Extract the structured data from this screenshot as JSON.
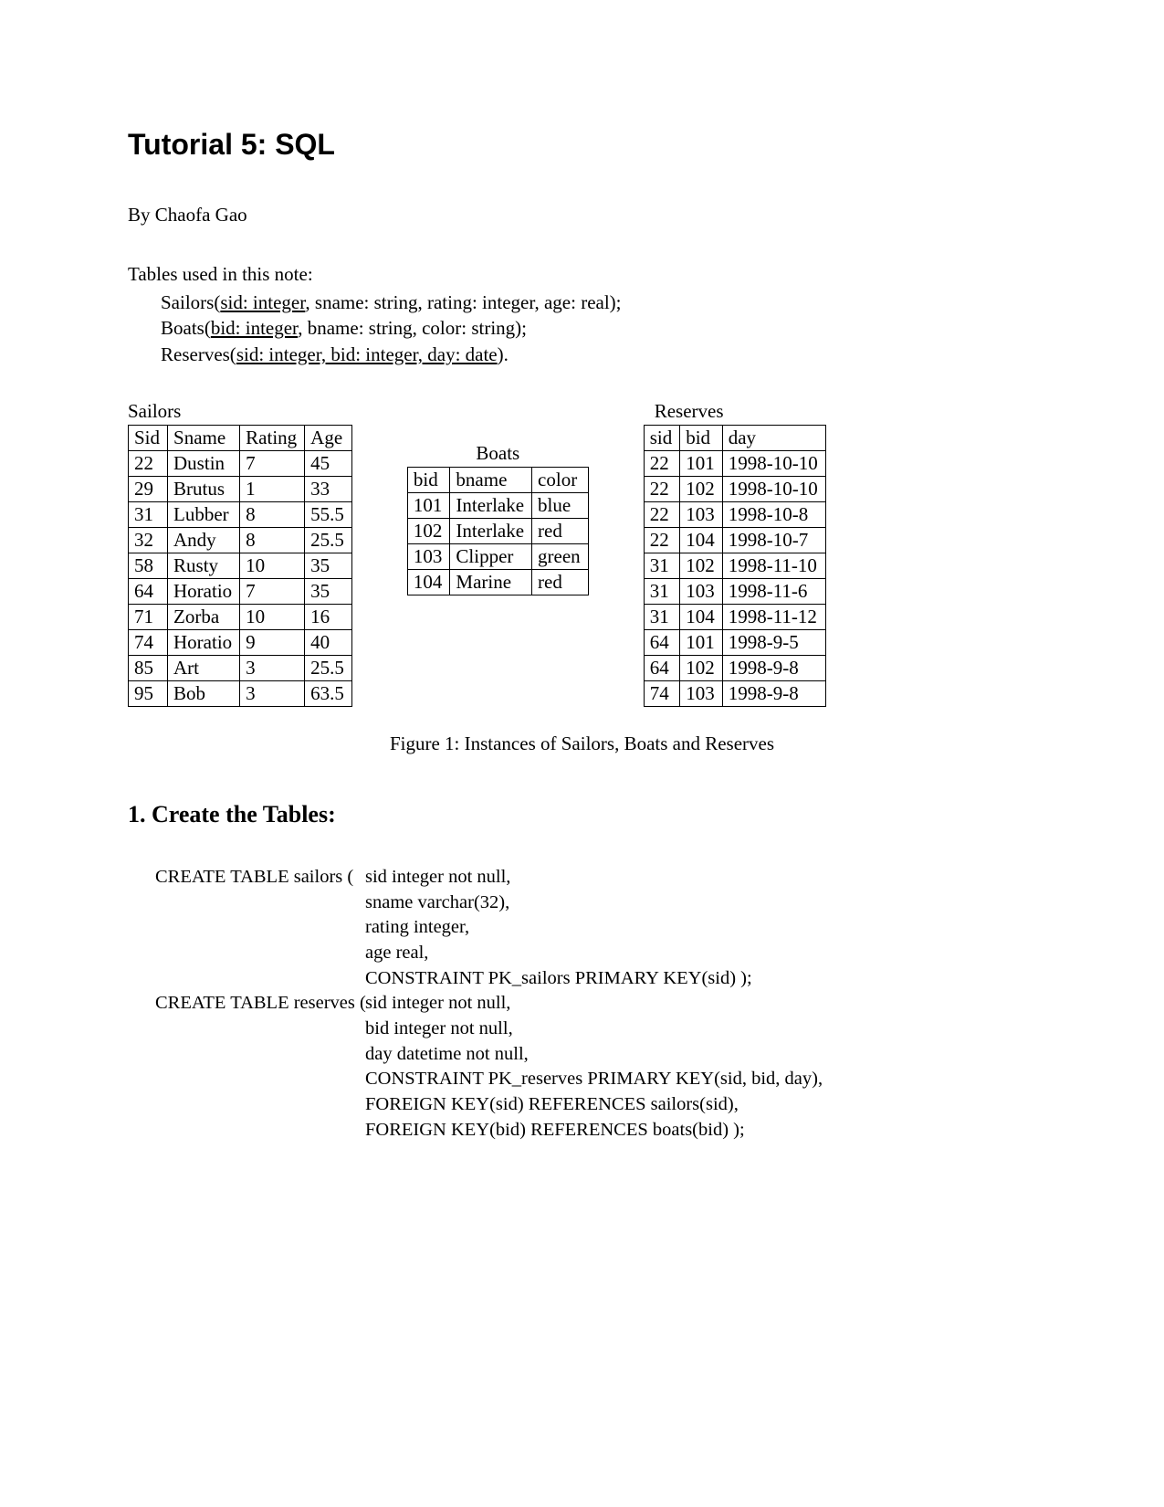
{
  "title": "Tutorial 5: SQL",
  "author": "By Chaofa Gao",
  "tables_intro": "Tables used in this note:",
  "schemas": {
    "sailors_prefix": "Sailors(",
    "sailors_u": "sid: integer",
    "sailors_rest": ", sname: string, rating: integer, age: real);",
    "boats_prefix": "Boats(",
    "boats_u": "bid: integer",
    "boats_rest": ", bname: string, color: string);",
    "reserves_prefix": "Reserves(",
    "reserves_u": "sid: integer, bid: integer, day: date",
    "reserves_rest": ")."
  },
  "sailors_label": "Sailors",
  "sailors_headers": [
    "Sid",
    "Sname",
    "Rating",
    "Age"
  ],
  "sailors_rows": [
    [
      "22",
      "Dustin",
      "7",
      "45"
    ],
    [
      "29",
      "Brutus",
      "1",
      "33"
    ],
    [
      "31",
      "Lubber",
      "8",
      "55.5"
    ],
    [
      "32",
      "Andy",
      "8",
      "25.5"
    ],
    [
      "58",
      "Rusty",
      "10",
      "35"
    ],
    [
      "64",
      "Horatio",
      "7",
      "35"
    ],
    [
      "71",
      "Zorba",
      "10",
      "16"
    ],
    [
      "74",
      "Horatio",
      "9",
      "40"
    ],
    [
      "85",
      "Art",
      "3",
      "25.5"
    ],
    [
      "95",
      "Bob",
      "3",
      "63.5"
    ]
  ],
  "boats_label": "Boats",
  "boats_headers": [
    "bid",
    "bname",
    "color"
  ],
  "boats_rows": [
    [
      "101",
      "Interlake",
      "blue"
    ],
    [
      "102",
      "Interlake",
      "red"
    ],
    [
      "103",
      "Clipper",
      "green"
    ],
    [
      "104",
      "Marine",
      "red"
    ]
  ],
  "reserves_label": "Reserves",
  "reserves_headers": [
    "sid",
    "bid",
    "day"
  ],
  "reserves_rows": [
    [
      "22",
      "101",
      "1998-10-10"
    ],
    [
      "22",
      "102",
      "1998-10-10"
    ],
    [
      "22",
      "103",
      "1998-10-8"
    ],
    [
      "22",
      "104",
      "1998-10-7"
    ],
    [
      "31",
      "102",
      "1998-11-10"
    ],
    [
      "31",
      "103",
      "1998-11-6"
    ],
    [
      "31",
      "104",
      "1998-11-12"
    ],
    [
      "64",
      "101",
      "1998-9-5"
    ],
    [
      "64",
      "102",
      "1998-9-8"
    ],
    [
      "74",
      "103",
      "1998-9-8"
    ]
  ],
  "figure_caption": "Figure 1: Instances of Sailors, Boats and Reserves",
  "section1": "1. Create the Tables:",
  "sql": {
    "l1": "CREATE TABLE sailors (",
    "r1": "sid integer not null,",
    "r2": "sname varchar(32),",
    "r3": "rating integer,",
    "r4": "age real,",
    "r5": "CONSTRAINT PK_sailors PRIMARY KEY(sid) );",
    "l2": "CREATE TABLE reserves (",
    "r6": "sid integer not null,",
    "r7": "bid integer not null,",
    "r8": "day datetime not null,",
    "r9": "CONSTRAINT PK_reserves PRIMARY KEY(sid, bid, day),",
    "r10": "FOREIGN KEY(sid) REFERENCES sailors(sid),",
    "r11": "FOREIGN KEY(bid) REFERENCES boats(bid) );"
  }
}
